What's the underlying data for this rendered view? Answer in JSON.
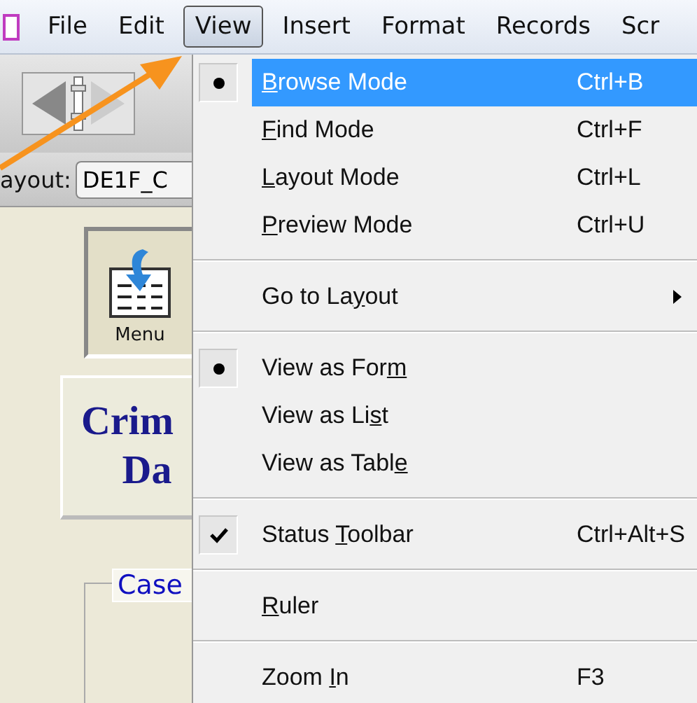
{
  "menu_bar": [
    {
      "label": "File",
      "selected": false
    },
    {
      "label": "Edit",
      "selected": false
    },
    {
      "label": "View",
      "selected": true
    },
    {
      "label": "Insert",
      "selected": false
    },
    {
      "label": "Format",
      "selected": false
    },
    {
      "label": "Records",
      "selected": false
    },
    {
      "label": "Scr",
      "selected": false
    }
  ],
  "toolbar": {
    "layout_label": "ayout:",
    "layout_value": "DE1F_C"
  },
  "form": {
    "menu_button": "Menu",
    "title_lines": [
      "Crim",
      "Da"
    ],
    "group_label": "Case"
  },
  "view_menu": [
    {
      "kind": "radio",
      "label": {
        "key": "B",
        "after": "rowse Mode"
      },
      "shortcut": "Ctrl+B",
      "selected": true,
      "checked": true
    },
    {
      "kind": "radio",
      "label": {
        "key": "F",
        "after": "ind Mode"
      },
      "shortcut": "Ctrl+F",
      "selected": false,
      "checked": false
    },
    {
      "kind": "radio",
      "label": {
        "key": "L",
        "after": "ayout Mode"
      },
      "shortcut": "Ctrl+L",
      "selected": false,
      "checked": false
    },
    {
      "kind": "radio",
      "label": {
        "key": "P",
        "after": "review Mode"
      },
      "shortcut": "Ctrl+U",
      "selected": false,
      "checked": false
    },
    {
      "kind": "separator"
    },
    {
      "kind": "command",
      "label": {
        "before": "Go to La",
        "key": "y",
        "after": "out"
      },
      "submenu": true,
      "selected": false
    },
    {
      "kind": "separator"
    },
    {
      "kind": "radio",
      "label": {
        "before": "View as For",
        "key": "m"
      },
      "selected": false,
      "checked": true
    },
    {
      "kind": "radio",
      "label": {
        "before": "View as Li",
        "key": "s",
        "after": "t"
      },
      "selected": false,
      "checked": false
    },
    {
      "kind": "radio",
      "label": {
        "before": "View as Tabl",
        "key": "e"
      },
      "selected": false,
      "checked": false
    },
    {
      "kind": "separator"
    },
    {
      "kind": "checkbox",
      "label": {
        "before": "Status ",
        "key": "T",
        "after": "oolbar"
      },
      "shortcut": "Ctrl+Alt+S",
      "selected": false,
      "checked": true
    },
    {
      "kind": "separator"
    },
    {
      "kind": "command",
      "label": {
        "key": "R",
        "after": "uler"
      },
      "selected": false
    },
    {
      "kind": "separator"
    },
    {
      "kind": "command",
      "label": {
        "before": "Zoom ",
        "key": "I",
        "after": "n"
      },
      "shortcut": "F3",
      "selected": false
    }
  ]
}
